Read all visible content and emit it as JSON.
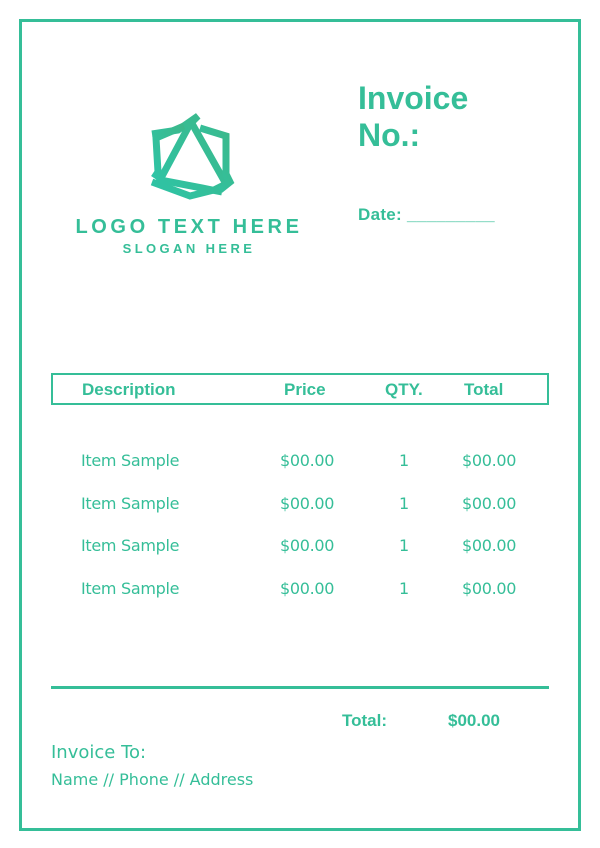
{
  "colors": {
    "accent": "#35BE98"
  },
  "logo": {
    "icon": "shield-triangle-knot-icon",
    "text": "LOGO TEXT HERE",
    "slogan": "SLOGAN HERE"
  },
  "header": {
    "title": "Invoice No.:",
    "title_line1": "Invoice",
    "title_line2": "No.:",
    "date_label": "Date: _________"
  },
  "table": {
    "columns": [
      "Description",
      "Price",
      "QTY.",
      "Total"
    ],
    "rows": [
      {
        "description": "Item Sample",
        "price": "$00.00",
        "qty": "1",
        "total": "$00.00"
      },
      {
        "description": "Item Sample",
        "price": "$00.00",
        "qty": "1",
        "total": "$00.00"
      },
      {
        "description": "Item Sample",
        "price": "$00.00",
        "qty": "1",
        "total": "$00.00"
      },
      {
        "description": "Item Sample",
        "price": "$00.00",
        "qty": "1",
        "total": "$00.00"
      }
    ]
  },
  "summary": {
    "total_label": "Total:",
    "total_value": "$00.00"
  },
  "billing": {
    "label": "Invoice To:",
    "details": "Name // Phone // Address"
  }
}
